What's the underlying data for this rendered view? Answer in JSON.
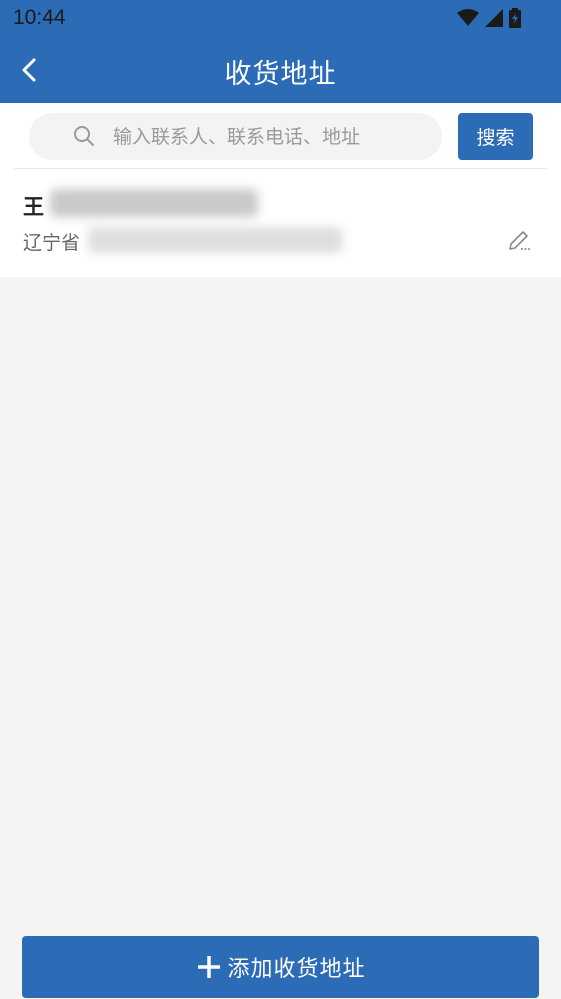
{
  "status_bar": {
    "time": "10:44",
    "icons": [
      "wifi-icon",
      "signal-icon",
      "battery-icon"
    ]
  },
  "nav": {
    "title": "收货地址",
    "back_icon": "chevron-left-icon"
  },
  "search": {
    "placeholder": "输入联系人、联系电话、地址",
    "value": "",
    "button_label": "搜索"
  },
  "addresses": [
    {
      "name_visible": "王",
      "address_visible": "辽宁省"
    }
  ],
  "footer": {
    "add_label": "添加收货地址"
  },
  "colors": {
    "primary": "#2c6bb5",
    "background": "#f4f4f4",
    "card": "#ffffff"
  }
}
